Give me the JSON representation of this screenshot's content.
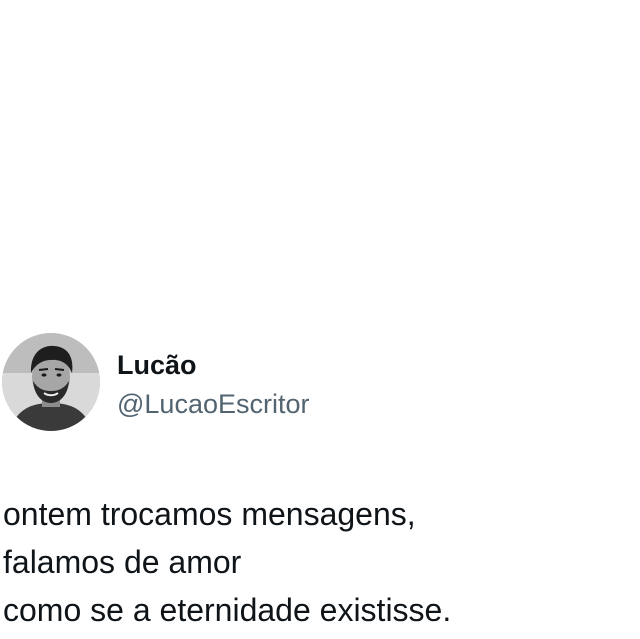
{
  "tweet": {
    "author": {
      "display_name": "Lucão",
      "handle": "@LucaoEscritor",
      "avatar_icon": "user-avatar-photo"
    },
    "text_lines": [
      "ontem trocamos mensagens,",
      "falamos de amor",
      "como se a eternidade existisse."
    ]
  },
  "colors": {
    "background": "#ffffff",
    "name_text": "#0f1419",
    "handle_text": "#536471",
    "body_text": "#0f1419"
  }
}
